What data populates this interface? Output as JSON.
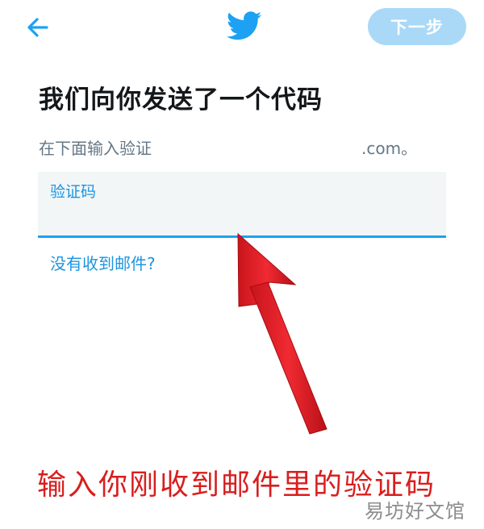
{
  "header": {
    "back_icon": "arrow-left-icon",
    "logo_icon": "bird-logo-icon",
    "next_label": "下一步",
    "accent_color": "#1da1f2",
    "next_button_color": "#a9d9f7"
  },
  "main": {
    "title": "我们向你发送了一个代码",
    "instruction": "在下面输入验证",
    "email_suffix": ".com。",
    "code_field": {
      "label": "验证码",
      "value": ""
    },
    "no_mail_link": "没有收到邮件?"
  },
  "annotation": {
    "caption": "输入你刚收到邮件里的验证码",
    "arrow_color": "#e8202a",
    "caption_color": "#d91e1e"
  },
  "watermark": {
    "text": "易坊好文馆"
  }
}
